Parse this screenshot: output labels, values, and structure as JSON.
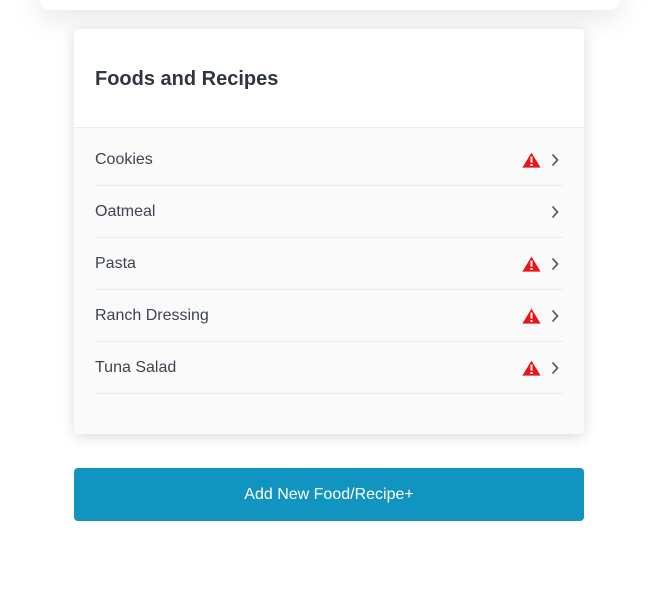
{
  "card": {
    "title": "Foods and Recipes"
  },
  "items": [
    {
      "label": "Cookies",
      "warning": true
    },
    {
      "label": "Oatmeal",
      "warning": false
    },
    {
      "label": "Pasta",
      "warning": true
    },
    {
      "label": "Ranch Dressing",
      "warning": true
    },
    {
      "label": "Tuna Salad",
      "warning": true
    }
  ],
  "add_button": {
    "label": "Add New Food/Recipe+"
  },
  "colors": {
    "warning": "#e8141a",
    "button": "#1194c0",
    "chevron": "#4a505a"
  }
}
